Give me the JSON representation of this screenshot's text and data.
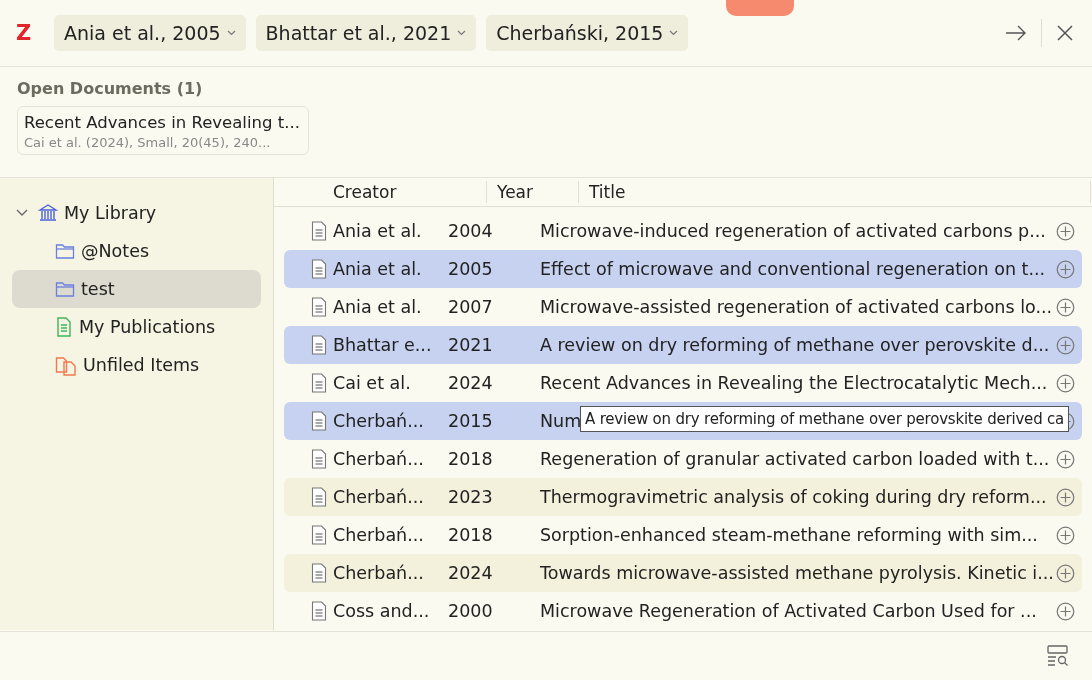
{
  "tabs": [
    {
      "label": "Ania et al., 2005"
    },
    {
      "label": "Bhattar et al., 2021"
    },
    {
      "label": "Cherbański, 2015"
    }
  ],
  "open_documents": {
    "heading": "Open Documents (1)",
    "items": [
      {
        "title": "Recent Advances in Revealing t...",
        "citation": "Cai et al. (2024), Small, 20(45), 240..."
      }
    ]
  },
  "sidebar": {
    "items": [
      {
        "label": "My Library",
        "kind": "library",
        "expanded": true,
        "selected": false,
        "children": [
          {
            "label": "@Notes",
            "kind": "folder",
            "selected": false
          },
          {
            "label": "test",
            "kind": "folder",
            "selected": true
          },
          {
            "label": "My Publications",
            "kind": "publications",
            "selected": false
          },
          {
            "label": "Unfiled Items",
            "kind": "unfiled",
            "selected": false
          }
        ]
      }
    ]
  },
  "table": {
    "columns": [
      "Creator",
      "Year",
      "Title"
    ],
    "rows": [
      {
        "creator": "Ania et al.",
        "year": "2004",
        "title": "Microwave-induced regeneration of activated carbons p...",
        "selected": false
      },
      {
        "creator": "Ania et al.",
        "year": "2005",
        "title": "Effect of microwave and conventional regeneration on t...",
        "selected": true
      },
      {
        "creator": "Ania et al.",
        "year": "2007",
        "title": "Microwave-assisted regeneration of activated carbons lo...",
        "selected": false
      },
      {
        "creator": "Bhattar e...",
        "year": "2021",
        "title": "A review on dry reforming of methane over perovskite d...",
        "selected": true
      },
      {
        "creator": "Cai et al.",
        "year": "2024",
        "title": "Recent Advances in Revealing the Electrocatalytic Mech...",
        "selected": false
      },
      {
        "creator": "Cherbań...",
        "year": "2015",
        "title": "Num",
        "selected": true
      },
      {
        "creator": "Cherbań...",
        "year": "2018",
        "title": "Regeneration of granular activated carbon loaded with t...",
        "selected": false
      },
      {
        "creator": "Cherbań...",
        "year": "2023",
        "title": "Thermogravimetric analysis of coking during dry reform...",
        "selected": false
      },
      {
        "creator": "Cherbań...",
        "year": "2018",
        "title": "Sorption-enhanced steam-methane reforming with sim...",
        "selected": false
      },
      {
        "creator": "Cherbań...",
        "year": "2024",
        "title": "Towards microwave-assisted methane pyrolysis. Kinetic i...",
        "selected": false
      },
      {
        "creator": "Coss and...",
        "year": "2000",
        "title": "Microwave Regeneration of Activated Carbon Used for ...",
        "selected": false
      }
    ]
  },
  "tooltip": "A review on dry reforming of methane over perovskite derived ca",
  "logo": "Z"
}
